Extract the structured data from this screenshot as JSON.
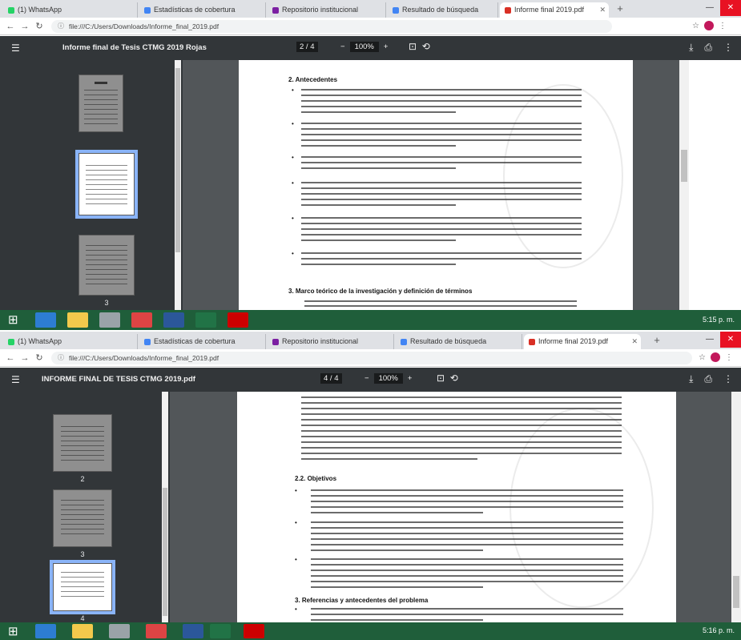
{
  "colors": {
    "tabstrip": "#dfe1e5",
    "pdf_toolbar": "#323639",
    "viewer_bg": "#525659",
    "selected_thumb": "#8ab4f8",
    "taskbar": "#1f5e3a",
    "close_button": "#e81123"
  },
  "top": {
    "tabs": [
      {
        "label": "(1) WhatsApp",
        "icon": "whatsapp-icon"
      },
      {
        "label": "Estadísticas de cobertura",
        "icon": "doc-icon"
      },
      {
        "label": "Repositorio institucional",
        "icon": "doc-icon"
      },
      {
        "label": "Resultado de búsqueda",
        "icon": "doc-icon"
      },
      {
        "label": "Informe final 2019.pdf",
        "icon": "pdf-icon"
      }
    ],
    "url": "file:///C:/Users/Downloads/Informe_final_2019.pdf",
    "pdf_title": "Informe final de Tesis CTMG 2019 Rojas",
    "page_indicator": "2 / 4",
    "zoom": "100%",
    "section_heading": "2. Antecedentes",
    "section_heading_2": "3. Marco teórico de la investigación y definición de términos",
    "thumb_page_label": "3",
    "tray_time": "5:15 p. m."
  },
  "bottom": {
    "tabs": [
      {
        "label": "(1) WhatsApp",
        "icon": "whatsapp-icon"
      },
      {
        "label": "Estadísticas de cobertura",
        "icon": "doc-icon"
      },
      {
        "label": "Repositorio institucional",
        "icon": "doc-icon"
      },
      {
        "label": "Resultado de búsqueda",
        "icon": "doc-icon"
      },
      {
        "label": "Informe final 2019.pdf",
        "icon": "pdf-icon"
      }
    ],
    "url": "file:///C:/Users/Downloads/Informe_final_2019.pdf",
    "pdf_title": "INFORME FINAL DE TESIS CTMG 2019.pdf",
    "page_indicator": "4 / 4",
    "zoom": "100%",
    "section_heading": "2.2. Objetivos",
    "section_heading_2": "3. Referencias y antecedentes del problema",
    "thumb_labels": [
      "2",
      "3",
      "4"
    ],
    "tray_time": "5:16 p. m."
  }
}
